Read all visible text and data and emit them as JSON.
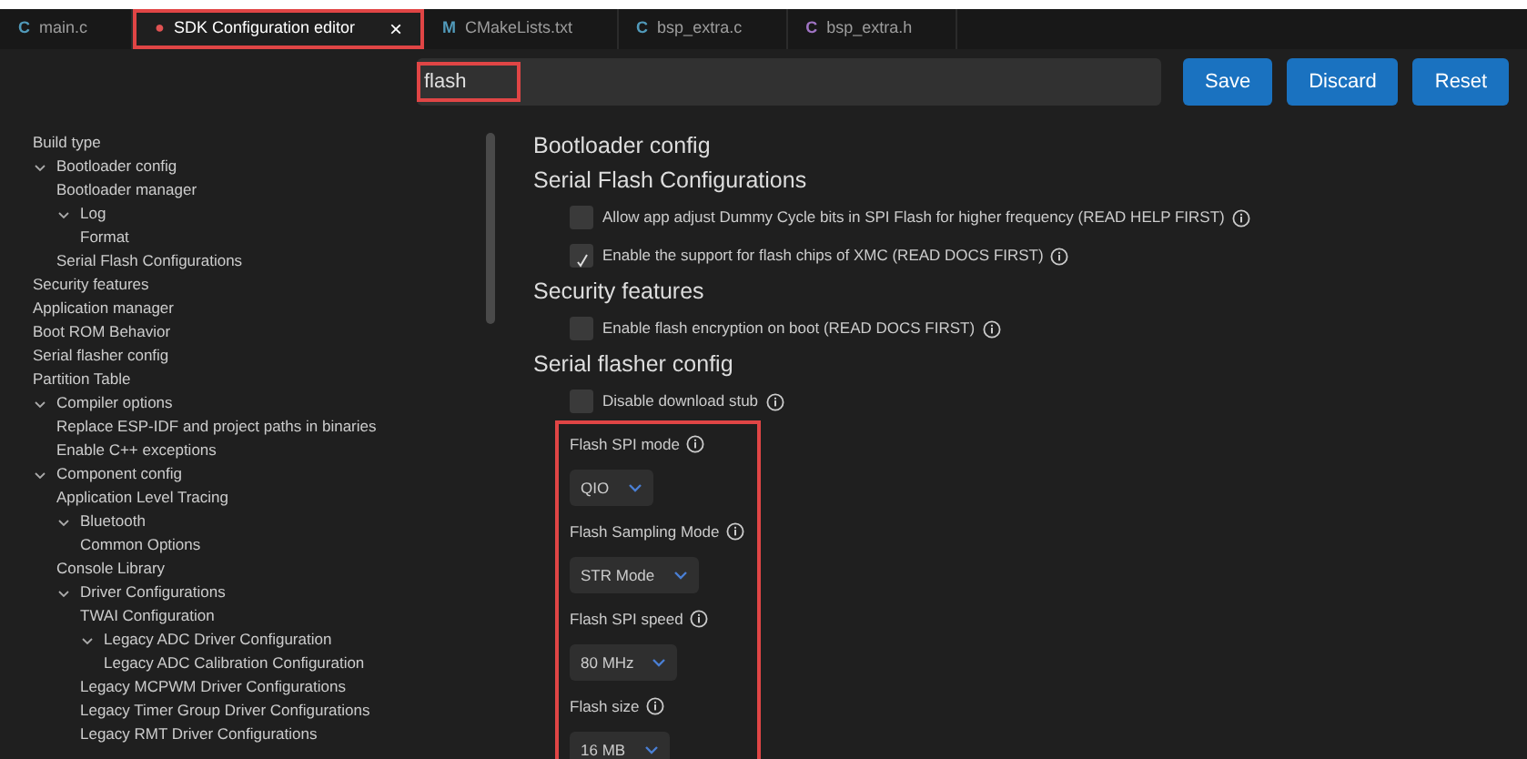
{
  "tabs": [
    {
      "icon": "C",
      "color": "#519aba",
      "label": "main.c",
      "selected": false,
      "closable": false,
      "highlighted": false
    },
    {
      "icon": "●",
      "color": "#e05252",
      "label": "SDK Configuration editor",
      "selected": true,
      "closable": true,
      "highlighted": true
    },
    {
      "icon": "M",
      "color": "#519aba",
      "label": "CMakeLists.txt",
      "selected": false,
      "closable": false,
      "highlighted": false
    },
    {
      "icon": "C",
      "color": "#519aba",
      "label": "bsp_extra.c",
      "selected": false,
      "closable": false,
      "highlighted": false
    },
    {
      "icon": "C",
      "color": "#a074c4",
      "label": "bsp_extra.h",
      "selected": false,
      "closable": false,
      "highlighted": false
    }
  ],
  "close_glyph": "×",
  "search": {
    "value": "flash",
    "highlighted": true
  },
  "buttons": [
    "Save",
    "Discard",
    "Reset"
  ],
  "tree": [
    {
      "label": "Build type"
    },
    {
      "label": "Bootloader config",
      "expanded": true,
      "children": [
        {
          "label": "Bootloader manager"
        },
        {
          "label": "Log",
          "expanded": true,
          "children": [
            {
              "label": "Format"
            }
          ]
        },
        {
          "label": "Serial Flash Configurations"
        }
      ]
    },
    {
      "label": "Security features"
    },
    {
      "label": "Application manager"
    },
    {
      "label": "Boot ROM Behavior"
    },
    {
      "label": "Serial flasher config"
    },
    {
      "label": "Partition Table"
    },
    {
      "label": "Compiler options",
      "expanded": true,
      "children": [
        {
          "label": "Replace ESP-IDF and project paths in binaries"
        },
        {
          "label": "Enable C++ exceptions"
        }
      ]
    },
    {
      "label": "Component config",
      "expanded": true,
      "children": [
        {
          "label": "Application Level Tracing"
        },
        {
          "label": "Bluetooth",
          "expanded": true,
          "children": [
            {
              "label": "Common Options"
            }
          ]
        },
        {
          "label": "Console Library"
        },
        {
          "label": "Driver Configurations",
          "expanded": true,
          "children": [
            {
              "label": "TWAI Configuration"
            },
            {
              "label": "Legacy ADC Driver Configuration",
              "expanded": true,
              "children": [
                {
                  "label": "Legacy ADC Calibration Configuration"
                }
              ]
            },
            {
              "label": "Legacy MCPWM Driver Configurations"
            },
            {
              "label": "Legacy Timer Group Driver Configurations"
            },
            {
              "label": "Legacy RMT Driver Configurations"
            }
          ]
        }
      ]
    }
  ],
  "sections": [
    {
      "title": "Bootloader config"
    },
    {
      "title": "Serial Flash Configurations",
      "items": [
        {
          "kind": "checkbox",
          "label": "Allow app adjust Dummy Cycle bits in SPI Flash for higher frequency (READ HELP FIRST)",
          "checked": false
        },
        {
          "kind": "checkbox",
          "label": "Enable the support for flash chips of XMC (READ DOCS FIRST)",
          "checked": true
        }
      ]
    },
    {
      "title": "Security features",
      "items": [
        {
          "kind": "checkbox",
          "label": "Enable flash encryption on boot (READ DOCS FIRST)",
          "checked": false
        }
      ]
    },
    {
      "title": "Serial flasher config",
      "items": [
        {
          "kind": "checkbox",
          "label": "Disable download stub",
          "checked": false
        }
      ],
      "highlighted_items": [
        {
          "kind": "select",
          "label": "Flash SPI mode",
          "value": "QIO"
        },
        {
          "kind": "select",
          "label": "Flash Sampling Mode",
          "value": "STR Mode"
        },
        {
          "kind": "select",
          "label": "Flash SPI speed",
          "value": "80 MHz"
        },
        {
          "kind": "select",
          "label": "Flash size",
          "value": "16 MB"
        }
      ]
    }
  ]
}
